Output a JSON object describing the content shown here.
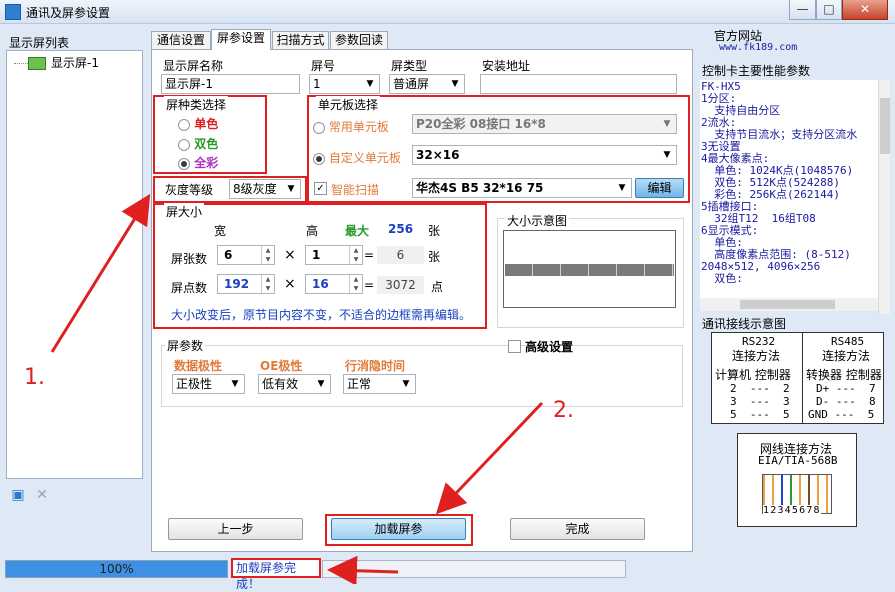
{
  "window": {
    "title": "通讯及屏参设置",
    "buttons": [
      "—",
      "□",
      "✕"
    ]
  },
  "sidebar": {
    "header": "显示屏列表",
    "items": [
      "显示屏-1"
    ]
  },
  "tabs": [
    "通信设置",
    "屏参设置",
    "扫描方式",
    "参数回读"
  ],
  "basic": {
    "name_label": "显示屏名称",
    "name_value": "显示屏-1",
    "no_label": "屏号",
    "no_value": "1",
    "type_label": "屏类型",
    "type_value": "普通屏",
    "addr_label": "安装地址",
    "addr_value": ""
  },
  "color_group": {
    "title": "屏种类选择",
    "options": [
      "单色",
      "双色",
      "全彩"
    ],
    "selected": "全彩",
    "colors": [
      "#e02020",
      "#2a9a2a",
      "#b030c0"
    ]
  },
  "gray": {
    "label": "灰度等级",
    "value": "8级灰度"
  },
  "unit": {
    "title": "单元板选择",
    "common_label": "常用单元板",
    "common_value": "P20全彩 08接口 16*8",
    "custom_label": "自定义单元板",
    "custom_value": "32×16",
    "smart_label": "智能扫描",
    "smart_value": "华杰4S B5 32*16 75",
    "edit_button": "编辑"
  },
  "size": {
    "title": "屏大小",
    "col_w": "宽",
    "col_h": "高",
    "max_label": "最大",
    "max_value": "256",
    "max_unit": "张",
    "count_label": "屏张数",
    "count_w": "6",
    "count_h": "1",
    "count_total": "6",
    "count_unit": "张",
    "dots_label": "屏点数",
    "dots_w": "192",
    "dots_h": "16",
    "dots_total": "3072",
    "dots_unit": "点",
    "times": "×",
    "equals": "=",
    "note": "大小改变后，原节目内容不变，不适合的边框需再编辑。"
  },
  "preview": {
    "title": "大小示意图"
  },
  "params": {
    "title": "屏参数",
    "advanced_label": "高级设置",
    "data_label": "数据极性",
    "data_value": "正极性",
    "oe_label": "OE极性",
    "oe_value": "低有效",
    "blank_label": "行消隐时间",
    "blank_value": "正常"
  },
  "actions": {
    "prev": "上一步",
    "load": "加载屏参",
    "finish": "完成"
  },
  "right": {
    "site_label": "官方网站",
    "site_url": "www.fk189.com",
    "perf_title": "控制卡主要性能参数",
    "info_lines": [
      "FK-HX5",
      "1分区:",
      "  支持自由分区",
      "2流水:",
      "  支持节目流水；支持分区流水",
      "3无设置",
      "4最大像素点:",
      "  单色: 1024K点(1048576)",
      "  双色: 512K点(524288)",
      "  彩色: 256K点(262144)",
      "5插槽接口:",
      "  32组T12  16组T08",
      "6显示模式:",
      "  单色:",
      "  高度像素点范围: (8-512)",
      "2048×512, 4096×256",
      "  双色:"
    ],
    "wiring_title": "通讯接线示意图",
    "rs232": {
      "title": "RS232",
      "sub": "连接方法",
      "head": "计算机 控制器",
      "rows": [
        "2  ---  2",
        "3  ---  3",
        "5  ---  5"
      ]
    },
    "rs485": {
      "title": "RS485",
      "sub": "连接方法",
      "head": "转换器 控制器",
      "rows": [
        "D+ ---  7",
        "D- ---  8",
        "GND ---  5"
      ]
    },
    "net_title": "网线连接方法",
    "net_sub": "EIA/TIA-568B",
    "net_pins": "12345678"
  },
  "status": {
    "progress_text": "100%",
    "progress": 1.0,
    "message": "加载屏参完成！"
  },
  "annotations": {
    "one": "1.",
    "two": "2."
  }
}
